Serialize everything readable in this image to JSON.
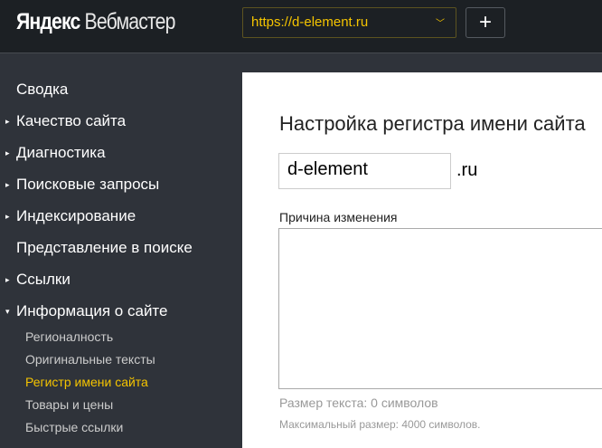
{
  "header": {
    "logo_brand": "Яндекс",
    "logo_product": "Вебмастер",
    "site_url": "https://d-element.ru",
    "add_label": "+"
  },
  "sidebar": {
    "items": [
      {
        "label": "Сводка",
        "arrow": ""
      },
      {
        "label": "Качество сайта",
        "arrow": "▸"
      },
      {
        "label": "Диагностика",
        "arrow": "▸"
      },
      {
        "label": "Поисковые запросы",
        "arrow": "▸"
      },
      {
        "label": "Индексирование",
        "arrow": "▸"
      },
      {
        "label": "Представление в поиске",
        "arrow": ""
      },
      {
        "label": "Ссылки",
        "arrow": "▸"
      },
      {
        "label": "Информация о сайте",
        "arrow": "▾"
      }
    ],
    "subitems": [
      "Регионалность",
      "Оригинальные тексты",
      "Регистр имени сайта",
      "Товары и цены",
      "Быстрые ссылки"
    ],
    "active_subitem": "Регистр имени сайта"
  },
  "main": {
    "title": "Настройка регистра имени сайта",
    "name_value": "d-element",
    "tld": ".ru",
    "reason_label": "Причина изменения",
    "reason_value": "",
    "size_text": "Размер текста: 0 символов",
    "max_text": "Максимальный размер: 4000 символов."
  },
  "colors": {
    "accent": "#f5c400",
    "header_bg": "#1c2024",
    "sidebar_bg": "#2f333a"
  }
}
